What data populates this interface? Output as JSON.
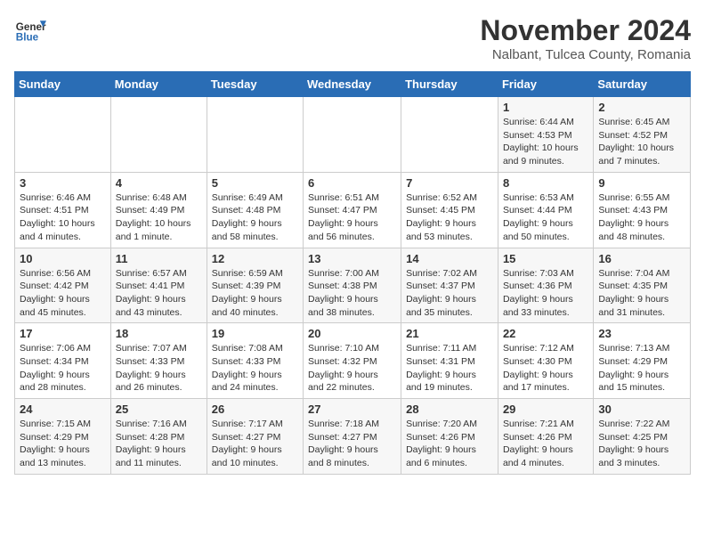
{
  "header": {
    "logo_general": "General",
    "logo_blue": "Blue",
    "month_title": "November 2024",
    "location": "Nalbant, Tulcea County, Romania"
  },
  "weekdays": [
    "Sunday",
    "Monday",
    "Tuesday",
    "Wednesday",
    "Thursday",
    "Friday",
    "Saturday"
  ],
  "weeks": [
    [
      {
        "num": "",
        "detail": ""
      },
      {
        "num": "",
        "detail": ""
      },
      {
        "num": "",
        "detail": ""
      },
      {
        "num": "",
        "detail": ""
      },
      {
        "num": "",
        "detail": ""
      },
      {
        "num": "1",
        "detail": "Sunrise: 6:44 AM\nSunset: 4:53 PM\nDaylight: 10 hours and 9 minutes."
      },
      {
        "num": "2",
        "detail": "Sunrise: 6:45 AM\nSunset: 4:52 PM\nDaylight: 10 hours and 7 minutes."
      }
    ],
    [
      {
        "num": "3",
        "detail": "Sunrise: 6:46 AM\nSunset: 4:51 PM\nDaylight: 10 hours and 4 minutes."
      },
      {
        "num": "4",
        "detail": "Sunrise: 6:48 AM\nSunset: 4:49 PM\nDaylight: 10 hours and 1 minute."
      },
      {
        "num": "5",
        "detail": "Sunrise: 6:49 AM\nSunset: 4:48 PM\nDaylight: 9 hours and 58 minutes."
      },
      {
        "num": "6",
        "detail": "Sunrise: 6:51 AM\nSunset: 4:47 PM\nDaylight: 9 hours and 56 minutes."
      },
      {
        "num": "7",
        "detail": "Sunrise: 6:52 AM\nSunset: 4:45 PM\nDaylight: 9 hours and 53 minutes."
      },
      {
        "num": "8",
        "detail": "Sunrise: 6:53 AM\nSunset: 4:44 PM\nDaylight: 9 hours and 50 minutes."
      },
      {
        "num": "9",
        "detail": "Sunrise: 6:55 AM\nSunset: 4:43 PM\nDaylight: 9 hours and 48 minutes."
      }
    ],
    [
      {
        "num": "10",
        "detail": "Sunrise: 6:56 AM\nSunset: 4:42 PM\nDaylight: 9 hours and 45 minutes."
      },
      {
        "num": "11",
        "detail": "Sunrise: 6:57 AM\nSunset: 4:41 PM\nDaylight: 9 hours and 43 minutes."
      },
      {
        "num": "12",
        "detail": "Sunrise: 6:59 AM\nSunset: 4:39 PM\nDaylight: 9 hours and 40 minutes."
      },
      {
        "num": "13",
        "detail": "Sunrise: 7:00 AM\nSunset: 4:38 PM\nDaylight: 9 hours and 38 minutes."
      },
      {
        "num": "14",
        "detail": "Sunrise: 7:02 AM\nSunset: 4:37 PM\nDaylight: 9 hours and 35 minutes."
      },
      {
        "num": "15",
        "detail": "Sunrise: 7:03 AM\nSunset: 4:36 PM\nDaylight: 9 hours and 33 minutes."
      },
      {
        "num": "16",
        "detail": "Sunrise: 7:04 AM\nSunset: 4:35 PM\nDaylight: 9 hours and 31 minutes."
      }
    ],
    [
      {
        "num": "17",
        "detail": "Sunrise: 7:06 AM\nSunset: 4:34 PM\nDaylight: 9 hours and 28 minutes."
      },
      {
        "num": "18",
        "detail": "Sunrise: 7:07 AM\nSunset: 4:33 PM\nDaylight: 9 hours and 26 minutes."
      },
      {
        "num": "19",
        "detail": "Sunrise: 7:08 AM\nSunset: 4:33 PM\nDaylight: 9 hours and 24 minutes."
      },
      {
        "num": "20",
        "detail": "Sunrise: 7:10 AM\nSunset: 4:32 PM\nDaylight: 9 hours and 22 minutes."
      },
      {
        "num": "21",
        "detail": "Sunrise: 7:11 AM\nSunset: 4:31 PM\nDaylight: 9 hours and 19 minutes."
      },
      {
        "num": "22",
        "detail": "Sunrise: 7:12 AM\nSunset: 4:30 PM\nDaylight: 9 hours and 17 minutes."
      },
      {
        "num": "23",
        "detail": "Sunrise: 7:13 AM\nSunset: 4:29 PM\nDaylight: 9 hours and 15 minutes."
      }
    ],
    [
      {
        "num": "24",
        "detail": "Sunrise: 7:15 AM\nSunset: 4:29 PM\nDaylight: 9 hours and 13 minutes."
      },
      {
        "num": "25",
        "detail": "Sunrise: 7:16 AM\nSunset: 4:28 PM\nDaylight: 9 hours and 11 minutes."
      },
      {
        "num": "26",
        "detail": "Sunrise: 7:17 AM\nSunset: 4:27 PM\nDaylight: 9 hours and 10 minutes."
      },
      {
        "num": "27",
        "detail": "Sunrise: 7:18 AM\nSunset: 4:27 PM\nDaylight: 9 hours and 8 minutes."
      },
      {
        "num": "28",
        "detail": "Sunrise: 7:20 AM\nSunset: 4:26 PM\nDaylight: 9 hours and 6 minutes."
      },
      {
        "num": "29",
        "detail": "Sunrise: 7:21 AM\nSunset: 4:26 PM\nDaylight: 9 hours and 4 minutes."
      },
      {
        "num": "30",
        "detail": "Sunrise: 7:22 AM\nSunset: 4:25 PM\nDaylight: 9 hours and 3 minutes."
      }
    ]
  ]
}
